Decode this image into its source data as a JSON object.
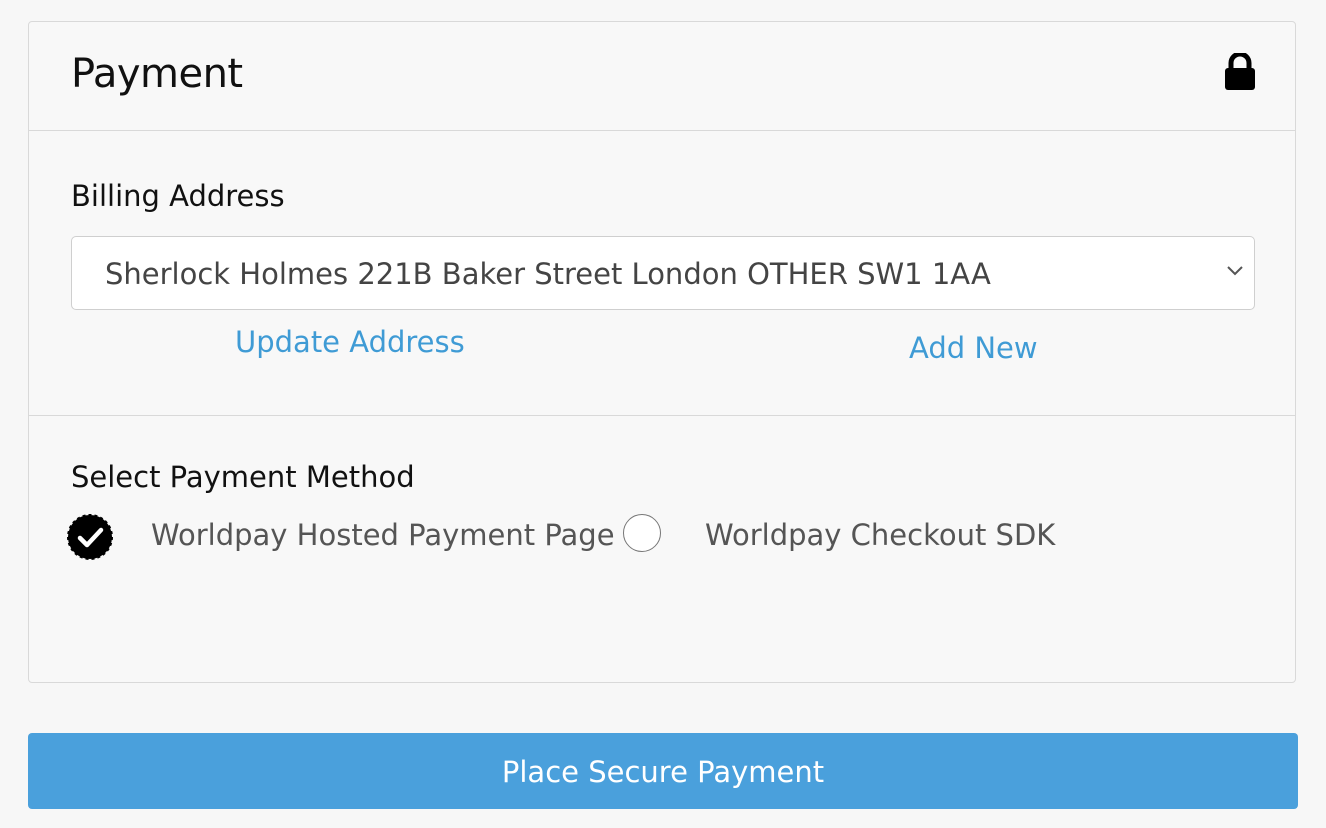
{
  "header": {
    "title": "Payment",
    "icon": "lock-icon"
  },
  "billing": {
    "label": "Billing Address",
    "selected_address": "Sherlock Holmes 221B Baker Street London OTHER SW1 1AA",
    "update_link": "Update Address",
    "add_link": "Add New"
  },
  "payment_method": {
    "label": "Select Payment Method",
    "options": [
      {
        "label": "Worldpay Hosted Payment Page",
        "selected": true
      },
      {
        "label": "Worldpay Checkout SDK",
        "selected": false
      }
    ]
  },
  "actions": {
    "submit_label": "Place Secure Payment"
  },
  "colors": {
    "accent": "#4aa0dc",
    "link": "#3f9bd5"
  }
}
